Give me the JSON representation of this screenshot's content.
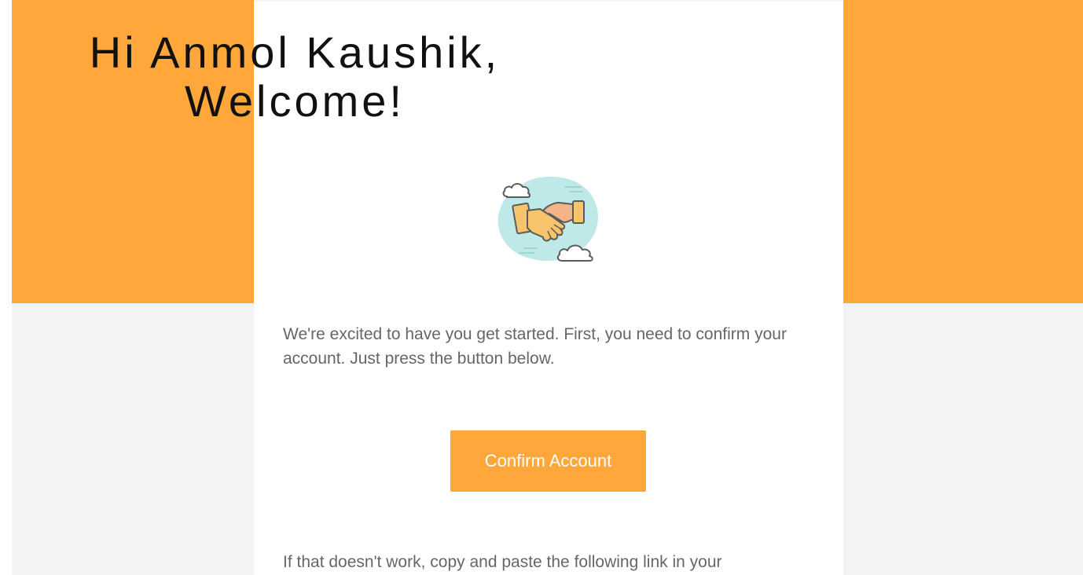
{
  "colors": {
    "brand": "#FFA73B",
    "page_background": "#f3f3f3",
    "card_background": "#ffffff",
    "heading_text": "#111111",
    "body_text": "#666666",
    "button_text": "#ffffff"
  },
  "header": {
    "line1": "Hi Anmol Kaushik,",
    "line2": "Welcome!"
  },
  "illustration": {
    "icon": "handshake-icon"
  },
  "body": {
    "intro_text": "We're excited to have you get started. First, you need to confirm your account. Just press the button below.",
    "fallback_text": "If that doesn't work, copy and paste the following link in your"
  },
  "cta": {
    "label": "Confirm Account"
  }
}
